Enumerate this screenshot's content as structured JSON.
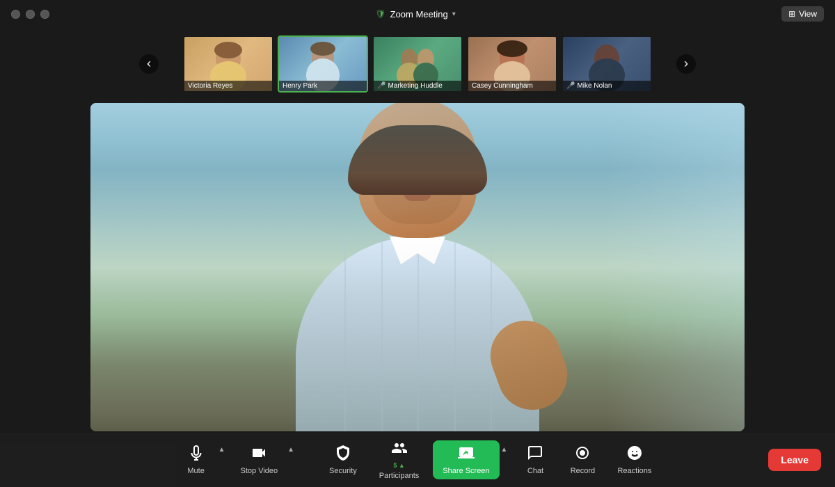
{
  "app": {
    "title": "Zoom Meeting",
    "title_chevron": "▾",
    "shield_icon": "🛡",
    "view_button": "View",
    "view_icon": "⊞"
  },
  "traffic_lights": [
    "●",
    "●",
    "●"
  ],
  "thumbnails": [
    {
      "id": "victoria",
      "name": "Victoria Reyes",
      "active": false,
      "emoji": "👩",
      "bg_class": "thumb-victoria"
    },
    {
      "id": "henry",
      "name": "Henry Park",
      "active": true,
      "emoji": "👨",
      "bg_class": "thumb-henry"
    },
    {
      "id": "marketing",
      "name": "Marketing Huddle",
      "active": false,
      "emoji": "👥",
      "bg_class": "thumb-marketing",
      "has_mic_off": true
    },
    {
      "id": "casey",
      "name": "Casey Cunningham",
      "active": false,
      "emoji": "👩",
      "bg_class": "thumb-casey"
    },
    {
      "id": "mike",
      "name": "Mike Nolan",
      "active": false,
      "emoji": "👨",
      "bg_class": "thumb-mike",
      "has_mic_off": true
    }
  ],
  "nav": {
    "prev": "‹",
    "next": "›"
  },
  "toolbar": {
    "mute": {
      "label": "Mute",
      "icon": "🎤"
    },
    "stop_video": {
      "label": "Stop Video",
      "icon": "📷"
    },
    "security": {
      "label": "Security",
      "icon": "🛡"
    },
    "participants": {
      "label": "Participants",
      "icon": "👥",
      "count": "5"
    },
    "share_screen": {
      "label": "Share Screen",
      "icon": "↑"
    },
    "chat": {
      "label": "Chat",
      "icon": "💬"
    },
    "record": {
      "label": "Record",
      "icon": "⏺"
    },
    "reactions": {
      "label": "Reactions",
      "icon": "😊"
    },
    "leave": "Leave"
  }
}
